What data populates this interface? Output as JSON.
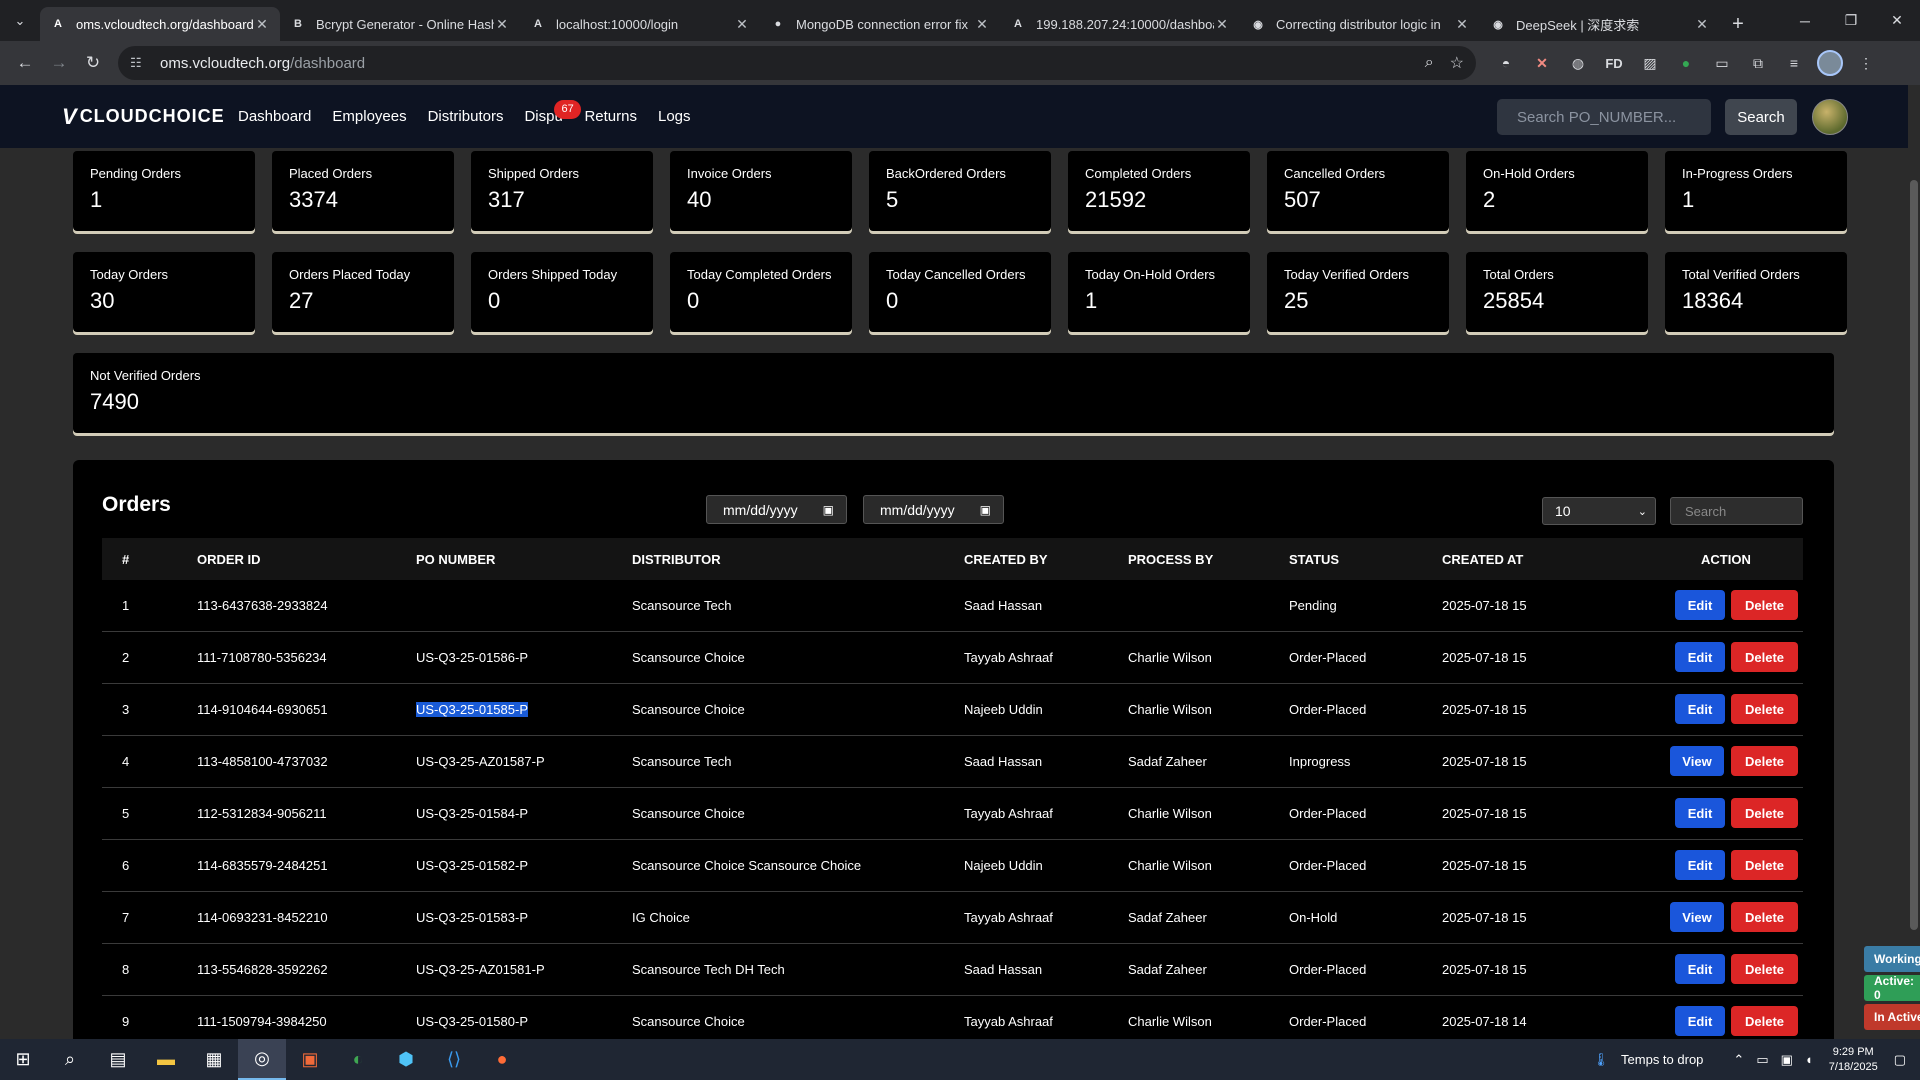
{
  "browser": {
    "tabs": [
      {
        "title": "oms.vcloudtech.org/dashboard",
        "icon": "A",
        "active": true
      },
      {
        "title": "Bcrypt Generator - Online Hash",
        "icon": "B"
      },
      {
        "title": "localhost:10000/login",
        "icon": "A"
      },
      {
        "title": "MongoDB connection error fix",
        "icon": "●"
      },
      {
        "title": "199.188.207.24:10000/dashboard",
        "icon": "A"
      },
      {
        "title": "Correcting distributor logic in",
        "icon": "◉"
      },
      {
        "title": "DeepSeek | 深度求索",
        "icon": "◉"
      }
    ],
    "url_host": "oms.vcloudtech.org",
    "url_path": "/dashboard",
    "extensions": {
      "fd": "FD"
    }
  },
  "app": {
    "logo_mark": "V",
    "logo_text": "CLOUDCHOICE",
    "nav": [
      "Dashboard",
      "Employees",
      "Distributors",
      "Disputes",
      "Returns",
      "Logs"
    ],
    "disputes_badge": "67",
    "search_placeholder": "Search PO_NUMBER...",
    "search_button": "Search"
  },
  "stats": [
    {
      "label": "Pending Orders",
      "value": "1"
    },
    {
      "label": "Placed Orders",
      "value": "3374"
    },
    {
      "label": "Shipped Orders",
      "value": "317"
    },
    {
      "label": "Invoice Orders",
      "value": "40"
    },
    {
      "label": "BackOrdered Orders",
      "value": "5"
    },
    {
      "label": "Completed Orders",
      "value": "21592"
    },
    {
      "label": "Cancelled Orders",
      "value": "507"
    },
    {
      "label": "On-Hold Orders",
      "value": "2"
    },
    {
      "label": "In-Progress Orders",
      "value": "1"
    },
    {
      "label": "Today Orders",
      "value": "30"
    },
    {
      "label": "Orders Placed Today",
      "value": "27"
    },
    {
      "label": "Orders Shipped Today",
      "value": "0"
    },
    {
      "label": "Today Completed Orders",
      "value": "0"
    },
    {
      "label": "Today Cancelled Orders",
      "value": "0"
    },
    {
      "label": "Today On-Hold Orders",
      "value": "1"
    },
    {
      "label": "Today Verified Orders",
      "value": "25"
    },
    {
      "label": "Total Orders",
      "value": "25854"
    },
    {
      "label": "Total Verified Orders",
      "value": "18364"
    },
    {
      "label": "Not Verified Orders",
      "value": "7490"
    }
  ],
  "orders": {
    "title": "Orders",
    "date_from": "mm/dd/yyyy",
    "date_to": "mm/dd/yyyy",
    "page_size": "10",
    "search_placeholder": "Search",
    "columns": [
      "#",
      "ORDER ID",
      "PO NUMBER",
      "DISTRIBUTOR",
      "CREATED BY",
      "PROCESS BY",
      "STATUS",
      "CREATED AT",
      "ACTION"
    ],
    "delete_label": "Delete",
    "rows": [
      {
        "n": "1",
        "order_id": "113-6437638-2933824",
        "po": "",
        "distributor": "Scansource Tech",
        "created_by": "Saad Hassan",
        "process_by": "",
        "status": "Pending",
        "created_at": "2025-07-18 15",
        "action": "Edit"
      },
      {
        "n": "2",
        "order_id": "111-7108780-5356234",
        "po": "US-Q3-25-01586-P",
        "distributor": "Scansource Choice",
        "created_by": "Tayyab Ashraaf",
        "process_by": "Charlie Wilson",
        "status": "Order-Placed",
        "created_at": "2025-07-18 15",
        "action": "Edit"
      },
      {
        "n": "3",
        "order_id": "114-9104644-6930651",
        "po": "US-Q3-25-01585-P",
        "distributor": "Scansource Choice",
        "created_by": "Najeeb Uddin",
        "process_by": "Charlie Wilson",
        "status": "Order-Placed",
        "created_at": "2025-07-18 15",
        "action": "Edit",
        "selected": true
      },
      {
        "n": "4",
        "order_id": "113-4858100-4737032",
        "po": "US-Q3-25-AZ01587-P",
        "distributor": "Scansource Tech",
        "created_by": "Saad Hassan",
        "process_by": "Sadaf Zaheer",
        "status": "Inprogress",
        "created_at": "2025-07-18 15",
        "action": "View"
      },
      {
        "n": "5",
        "order_id": "112-5312834-9056211",
        "po": "US-Q3-25-01584-P",
        "distributor": "Scansource Choice",
        "created_by": "Tayyab Ashraaf",
        "process_by": "Charlie Wilson",
        "status": "Order-Placed",
        "created_at": "2025-07-18 15",
        "action": "Edit"
      },
      {
        "n": "6",
        "order_id": "114-6835579-2484251",
        "po": "US-Q3-25-01582-P",
        "distributor": "Scansource Choice Scansource Choice",
        "created_by": "Najeeb Uddin",
        "process_by": "Charlie Wilson",
        "status": "Order-Placed",
        "created_at": "2025-07-18 15",
        "action": "Edit"
      },
      {
        "n": "7",
        "order_id": "114-0693231-8452210",
        "po": "US-Q3-25-01583-P",
        "distributor": "IG Choice",
        "created_by": "Tayyab Ashraaf",
        "process_by": "Sadaf Zaheer",
        "status": "On-Hold",
        "created_at": "2025-07-18 15",
        "action": "View"
      },
      {
        "n": "8",
        "order_id": "113-5546828-3592262",
        "po": "US-Q3-25-AZ01581-P",
        "distributor": "Scansource Tech DH Tech",
        "created_by": "Saad Hassan",
        "process_by": "Sadaf Zaheer",
        "status": "Order-Placed",
        "created_at": "2025-07-18 15",
        "action": "Edit"
      },
      {
        "n": "9",
        "order_id": "111-1509794-3984250",
        "po": "US-Q3-25-01580-P",
        "distributor": "Scansource Choice",
        "created_by": "Tayyab Ashraaf",
        "process_by": "Charlie Wilson",
        "status": "Order-Placed",
        "created_at": "2025-07-18 14",
        "action": "Edit"
      }
    ]
  },
  "side_tags": [
    {
      "label": "Working",
      "color": "#3a7ca5"
    },
    {
      "label": "Active: 0",
      "color": "#2f9e57"
    },
    {
      "label": "In Active",
      "color": "#c0392b"
    }
  ],
  "taskbar": {
    "weather": "Temps to drop",
    "time": "9:29 PM",
    "date": "7/18/2025"
  }
}
